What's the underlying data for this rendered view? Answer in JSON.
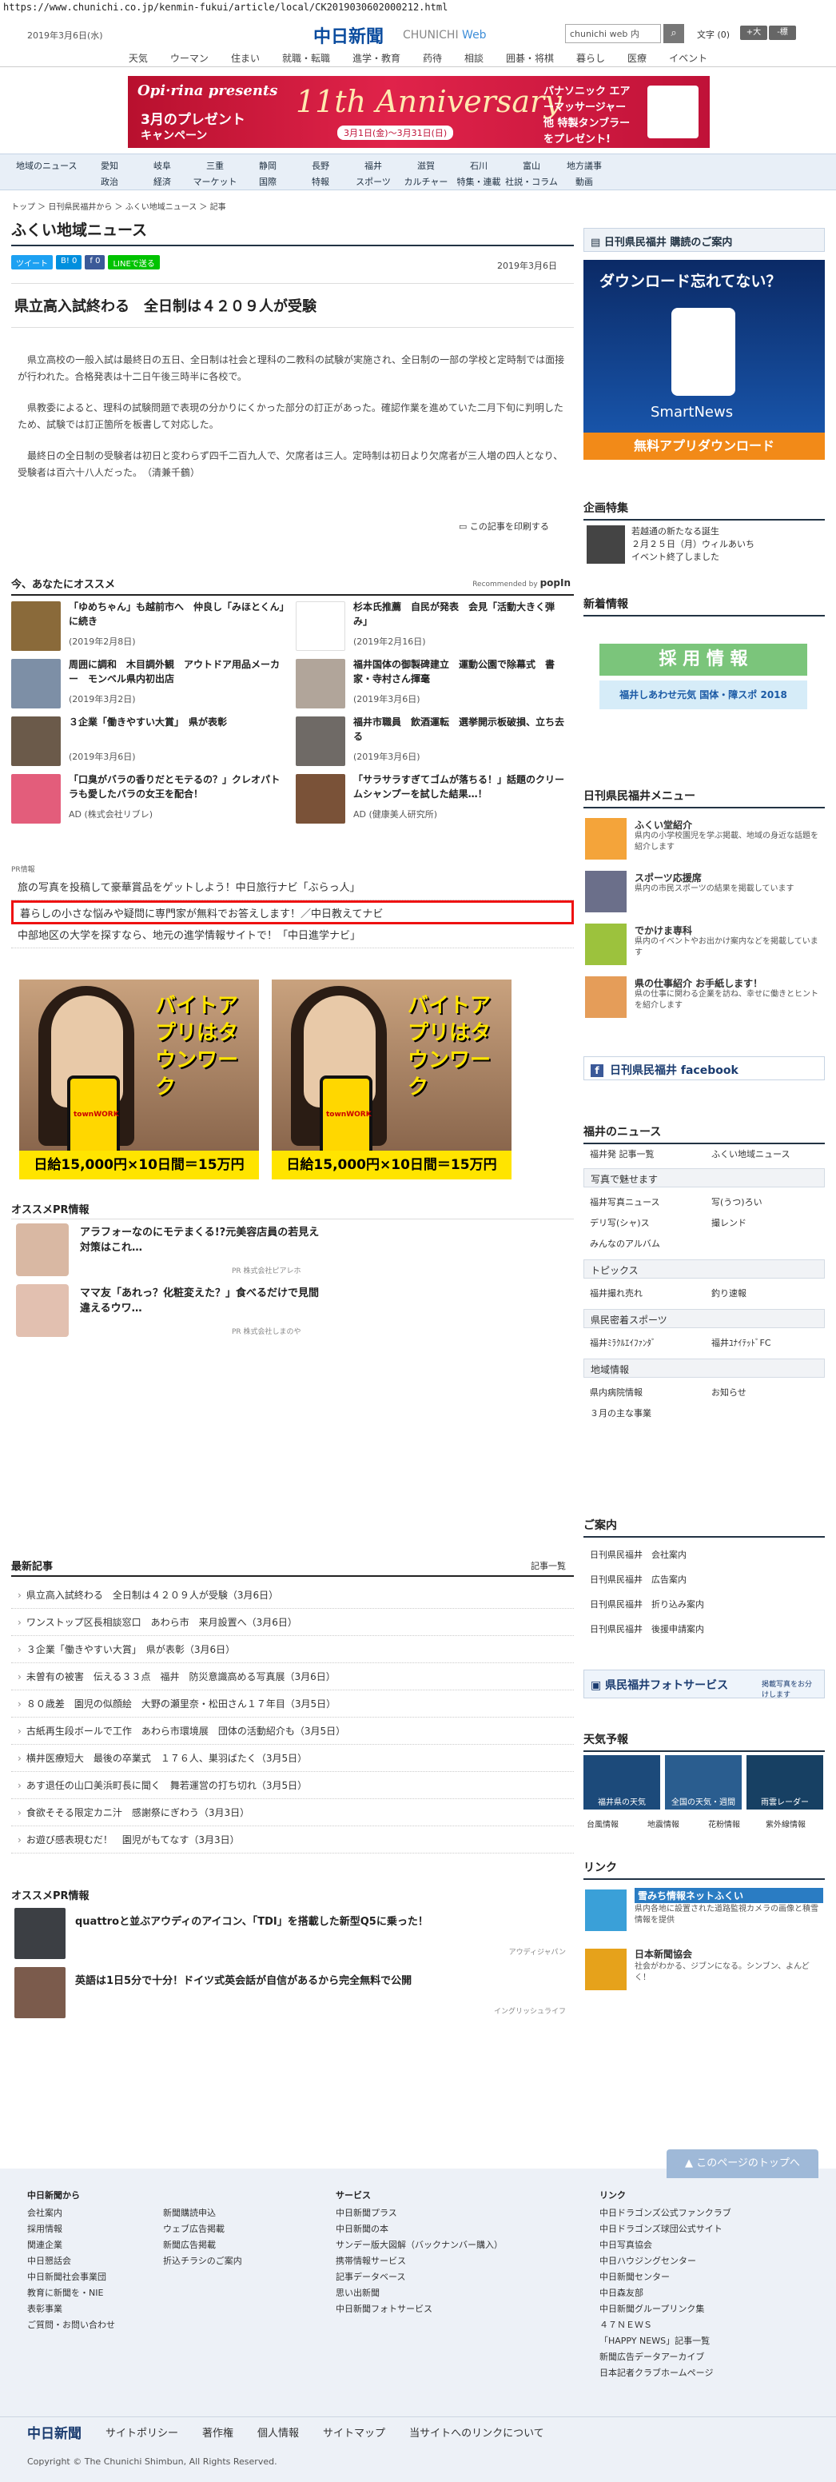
{
  "browser": {
    "url": "https://www.chunichi.co.jp/kenmin-fukui/article/local/CK2019030602000212.html"
  },
  "header": {
    "date": "2019年3月6日(水)",
    "logo": "中日新聞",
    "logo_en_1": "CHUNICHI",
    "logo_en_2": "Web",
    "search_value": "chunichi web 内",
    "font_size_label": "文字",
    "font_size_value": "(0)",
    "font_plus": "+大",
    "font_minus": "-標"
  },
  "category_nav": [
    "天気",
    "ウーマン",
    "住まい",
    "就職・転職",
    "進学・教育",
    "药待",
    "相談",
    "囲碁・将棋",
    "暮らし",
    "医療",
    "イベント"
  ],
  "banner": {
    "brand": "Opi·rina presents",
    "line1": "3月のプレゼント",
    "line2": "キャンペーン",
    "anniversary": "11th Anniversary",
    "period": "3月1日(金)～3月31日(日)",
    "promo": "パナソニック エアーマッサージャー 他 特製タンブラーをプレゼント!"
  },
  "section_nav": {
    "row1": [
      "地域のニュース",
      "愛知",
      "岐阜",
      "三重",
      "静岡",
      "長野",
      "福井",
      "滋賀",
      "石川",
      "富山",
      "地方議事"
    ],
    "row2": [
      "政治",
      "経済",
      "マーケット",
      "国際",
      "特報",
      "スポーツ",
      "カルチャー",
      "特集・連載",
      "社説・コラム",
      "動画"
    ]
  },
  "breadcrumb": "トップ ＞ 日刊県民福井から ＞ ふくい地域ニュース ＞ 記事",
  "section_title": "ふくい地域ニュース",
  "share": {
    "tweet": "ツイート",
    "b": "B! 0",
    "f": "f 0",
    "line": "LINEで送る"
  },
  "article": {
    "date": "2019年3月6日",
    "headline": "県立高入試終わる　全日制は４２０９人が受験",
    "paragraphs": [
      "県立高校の一般入試は最終日の五日、全日制は社会と理科の二教科の試験が実施され、全日制の一部の学校と定時制では面接が行われた。合格発表は十二日午後三時半に各校で。",
      "県教委によると、理科の試験問題で表現の分かりにくかった部分の訂正があった。確認作業を進めていた二月下旬に判明したため、試験では訂正箇所を板書して対応した。",
      "最終日の全日制の受験者は初日と変わらず四千二百九人で、欠席者は三人。定時制は初日より欠席者が三人増の四人となり、受験者は百六十八人だった。　（清兼千鶴）"
    ],
    "print": "この記事を印刷する"
  },
  "recommend": {
    "title": "今、あなたにオススメ",
    "powered": "Recommended by",
    "powered_brand": "popIn",
    "items": [
      {
        "title": "「ゆめちゃん」も越前市へ　仲良し「みほとくん」に続き",
        "date": "(2019年2月8日)"
      },
      {
        "title": "杉本氏推薦　自民が発表　会見「活動大きく弾み」",
        "date": "(2019年2月16日)"
      },
      {
        "title": "周囲に調和　木目調外観　アウトドア用品メーカー　モンベル県内初出店",
        "date": "(2019年3月2日)"
      },
      {
        "title": "福井国体の御製碑建立　運動公園で除幕式　書家・寺村さん揮毫",
        "date": "(2019年3月6日)"
      },
      {
        "title": "３企業「働きやすい大賞」　県が表彰",
        "date": "(2019年3月6日)"
      },
      {
        "title": "福井市職員　飲酒運転　選挙開示板破損、立ち去る",
        "date": "(2019年3月6日)"
      },
      {
        "title": "「口臭がバラの香りだとモテるの？」クレオパトラも愛したバラの女王を配合！",
        "date": "AD (株式会社リブレ)"
      },
      {
        "title": "「サラサラすぎてゴムが落ちる！」話題のクリームシャンプーを試した結果…！",
        "date": "AD (健康美人研究所)"
      }
    ]
  },
  "pr": {
    "label": "PR情報",
    "links": [
      "旅の写真を投稿して豪華賞品をゲットしよう！中日旅行ナビ「ぶらっ人」",
      "暮らしの小さな悩みや疑問に専門家が無料でお答えします！／中日教えてナビ",
      "中部地区の大学を探すなら、地元の進学情報サイトで！「中日進学ナビ」"
    ]
  },
  "ads": {
    "text": "バイトアプリはタウンワーク",
    "brand": "townWORK",
    "bar": "日給15,000円×10日間＝15万円"
  },
  "pr_info": {
    "title": "オススメPR情報",
    "items": [
      {
        "title": "アラフォーなのにモテまくる!?元美容店員の若見え対策はこれ…",
        "sponsor": "PR 株式会社ピアレホ"
      },
      {
        "title": "ママ友「あれっ？化粧変えた？」食べるだけで見間違えるウワ…",
        "sponsor": "PR 株式会社しまのや"
      }
    ]
  },
  "latest": {
    "title": "最新記事",
    "more": "記事一覧",
    "items": [
      "県立高入試終わる　全日制は４２０９人が受験（3月6日）",
      "ワンストップ区長相談窓口　あわら市　来月設置へ（3月6日）",
      "３企業「働きやすい大賞」　県が表彰（3月6日）",
      "未曽有の被害　伝える３３点　福井　防災意識高める写真展（3月6日）",
      "８０歳差　園児の似顔絵　大野の瀬里奈・松田さん１７年目（3月5日）",
      "古紙再生段ボールで工作　あわら市環境展　団体の活動紹介も（3月5日）",
      "横井医療短大　最後の卒業式　１７６人、巣羽ばたく（3月5日）",
      "あす退任の山口美浜町長に聞く　舞若運営の打ち切れ（3月5日）",
      "食欲そそる限定カニ汁　感謝祭にぎわう（3月3日）",
      "お遊び感表現むだ！　園児がもてなす（3月3日）"
    ]
  },
  "pr2": {
    "title": "オススメPR情報",
    "items": [
      {
        "title": "quattroと並ぶアウディのアイコン、「TDI」を搭載した新型Q5に乗った！",
        "sponsor": "アウディジャパン"
      },
      {
        "title": "英語は1日5分で十分！ドイツ式英会話が自信があるから完全無料で公開",
        "sponsor": "イングリッシュライフ"
      }
    ]
  },
  "sidebar": {
    "subscribe": "日刊県民福井 購読のご案内",
    "smartnews_title": "ダウンロード忘れてない？",
    "smartnews_brand": "SmartNews",
    "smartnews_cta": "無料アプリダウンロード",
    "feature_title": "企画特集",
    "feature_text": "若越通の新たなる誕生",
    "feature_date": "２月２５日（月）ウィルあいち",
    "feature_note": "イベント終了しました",
    "news_title": "新着情報",
    "recruit": "採 用 情 報",
    "recruit_sub": "福井しあわせ元気 国体・障スポ 2018",
    "menu_title": "日刊県民福井メニュー",
    "menu": [
      {
        "t": "ふくい堂紹介",
        "d": "県内の小学校園児を学ぶ掲載、地域の身近な話題を紹介します"
      },
      {
        "t": "スポーツ応援席",
        "d": "県内の市民スポーツの結果を掲載しています"
      },
      {
        "t": "でかけま専科",
        "d": "県内のイベントやお出かけ案内などを掲載しています"
      },
      {
        "t": "県の仕事紹介 お手紙します！",
        "d": "県の仕事に関わる企業を訪ね、幸せに働きとヒントを紹介します"
      }
    ],
    "facebook": "日刊県民福井 facebook",
    "fukui_news_title": "福井のニュース",
    "fukui_news": [
      "福井発 記事一覧",
      "ふくい地域ニュース"
    ],
    "photo_head": "写真で魅せます",
    "photo": [
      "福井写真ニュース",
      "写(うつ)ろい",
      "デリ写(シャ)ス",
      "撮レンド",
      "みんなのアルバム"
    ],
    "topics_head": "トピックス",
    "topics": [
      "福井撮れ売れ",
      "釣り速報"
    ],
    "sports_head": "県民密着スポーツ",
    "sports": [
      "福井ﾐﾗｸﾙｴｲﾌｧﾝﾀﾞ",
      "福井ﾕﾅｲﾃｯﾄﾞFC"
    ],
    "region_head": "地域情報",
    "region": [
      "県内病院情報",
      "お知らせ",
      "３月の主な事業"
    ],
    "guide_title": "ご案内",
    "guide": [
      "日刊県民福井　会社案内",
      "日刊県民福井　広告案内",
      "日刊県民福井　折り込み案内",
      "日刊県民福井　後援申請案内"
    ],
    "photo_service": "県民福井フォトサービス",
    "photo_service_note": "掲載写真をお分けします",
    "weather_title": "天気予報",
    "weather": [
      "福井県の天気",
      "全国の天気・週間",
      "雨雲レーダー"
    ],
    "weather_links": [
      "台風情報",
      "地震情報",
      "花粉情報",
      "紫外線情報"
    ],
    "links_title": "リンク",
    "links": [
      {
        "t": "雪みち情報ネットふくい",
        "d": "県内各地に設置された道路監視カメラの画像と積雪情報を提供"
      },
      {
        "t": "日本新聞協会",
        "d": "社会がわかる、ジブンになる。シンブン、よんどく！"
      }
    ]
  },
  "footer": {
    "back_to_top": "このページのトップへ",
    "col1_head": "中日新聞から",
    "col1": [
      "会社案内",
      "採用情報",
      "関連企業",
      "中日懇話会",
      "中日新聞社会事業団",
      "教育に新聞を・NIE",
      "表彰事業",
      "ご質問・お問い合わせ"
    ],
    "col2": [
      "新聞購読申込",
      "ウェブ広告掲載",
      "新聞広告掲載",
      "折込チラシのご案内"
    ],
    "col3_head": "サービス",
    "col3": [
      "中日新聞プラス",
      "中日新聞の本",
      "サンデー版大図解（バックナンバー購入）",
      "携帯情報サービス",
      "記事データベース",
      "思い出新聞",
      "中日新聞フォトサービス"
    ],
    "col4_head": "リンク",
    "col4": [
      "中日ドラゴンズ公式ファンクラブ",
      "中日ドラゴンズ球団公式サイト",
      "中日写真協会",
      "中日ハウジングセンター",
      "中日新聞センター",
      "中日森友部",
      "中日新聞グループリンク集",
      "４７ＮＥＷＳ",
      "「HAPPY NEWS」記事一覧",
      "新聞広告データアーカイブ",
      "日本記者クラブホームページ"
    ],
    "bottom_logo": "中日新聞",
    "bottom_links": [
      "サイトポリシー",
      "著作権",
      "個人情報",
      "サイトマップ",
      "当サイトへのリンクについて"
    ],
    "copyright": "Copyright © The Chunichi Shimbun, All Rights Reserved."
  }
}
